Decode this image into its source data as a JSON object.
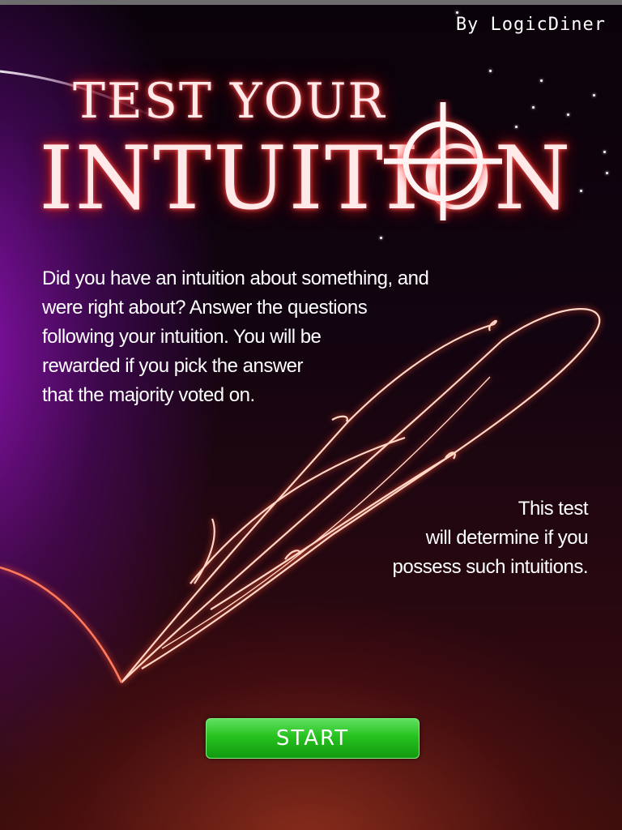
{
  "app": {
    "credit": "By LogicDiner",
    "title_line1": "TEST YOUR",
    "title_line2": "INTUITION"
  },
  "intro": {
    "lines": [
      "Did you have an intuition about something, and",
      "were right about? Answer  the  questions",
      "following your intuition. You will be",
      "rewarded if  you pick the answer",
      "that the majority voted on."
    ]
  },
  "outro": {
    "lines": [
      "This test",
      "will determine if you",
      "possess such intuitions."
    ]
  },
  "actions": {
    "start_label": "START"
  },
  "colors": {
    "accent_glow": "#c01818",
    "start_green": "#27c21f",
    "background_purple": "#9614be"
  },
  "icons": {
    "crosshair": "crosshair-icon",
    "feather": "feather-illustration"
  }
}
